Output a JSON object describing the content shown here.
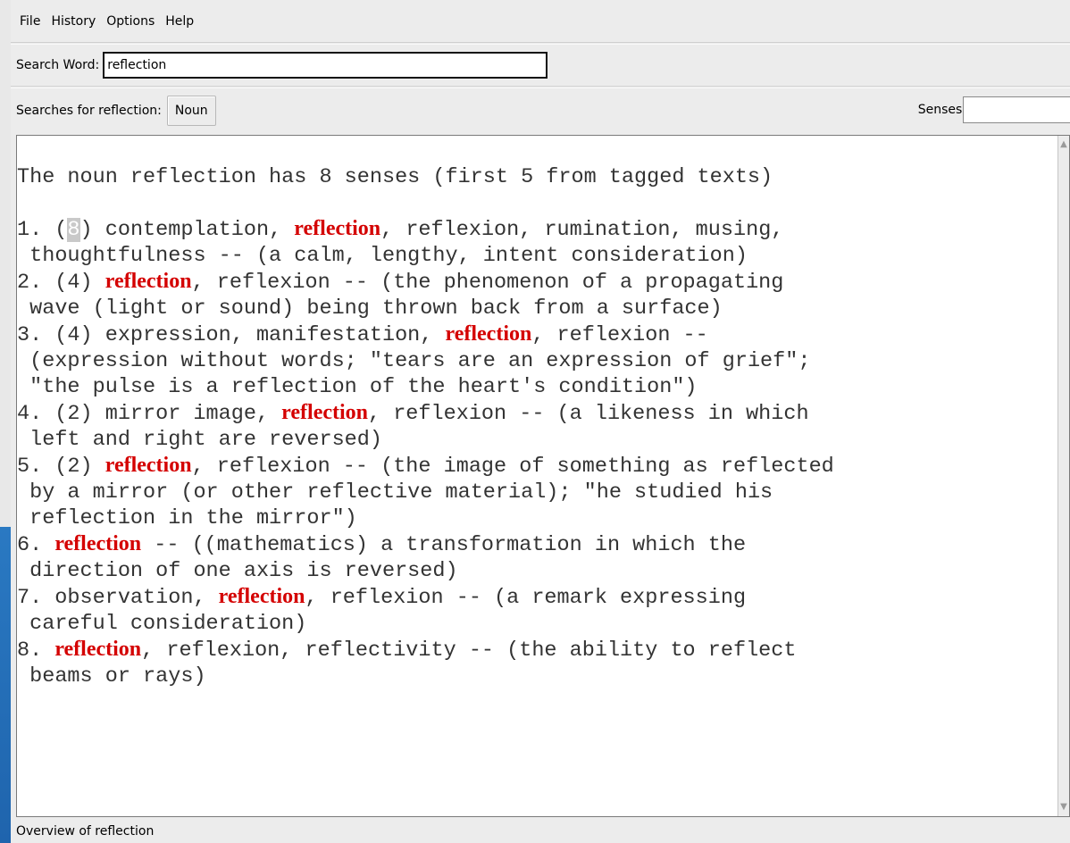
{
  "menu": [
    "File",
    "History",
    "Options",
    "Help"
  ],
  "search": {
    "label": "Search Word:",
    "value": "reflection"
  },
  "searches": {
    "label": "Searches for reflection:",
    "noun_button": "Noun",
    "senses_label": "Senses:",
    "senses_value": ""
  },
  "content": {
    "lines": [
      {
        "parts": [
          {
            "t": "The noun reflection has 8 senses (first 5 from tagged texts)"
          }
        ]
      },
      {
        "parts": [
          {
            "t": ""
          }
        ]
      },
      {
        "parts": [
          {
            "t": "1. ("
          },
          {
            "t": "8",
            "sel": true
          },
          {
            "t": ") contemplation, "
          },
          {
            "t": "reflection",
            "hl": true
          },
          {
            "t": ", reflexion, rumination, musing,"
          }
        ]
      },
      {
        "parts": [
          {
            "t": " thoughtfulness -- (a calm, lengthy, intent consideration)"
          }
        ]
      },
      {
        "parts": [
          {
            "t": "2. (4) "
          },
          {
            "t": "reflection",
            "hl": true
          },
          {
            "t": ", reflexion -- (the phenomenon of a propagating"
          }
        ]
      },
      {
        "parts": [
          {
            "t": " wave (light or sound) being thrown back from a surface)"
          }
        ]
      },
      {
        "parts": [
          {
            "t": "3. (4) expression, manifestation, "
          },
          {
            "t": "reflection",
            "hl": true
          },
          {
            "t": ", reflexion --"
          }
        ]
      },
      {
        "parts": [
          {
            "t": " (expression without words; \"tears are an expression of grief\";"
          }
        ]
      },
      {
        "parts": [
          {
            "t": " \"the pulse is a reflection of the heart's condition\")"
          }
        ]
      },
      {
        "parts": [
          {
            "t": "4. (2) mirror image, "
          },
          {
            "t": "reflection",
            "hl": true
          },
          {
            "t": ", reflexion -- (a likeness in which"
          }
        ]
      },
      {
        "parts": [
          {
            "t": " left and right are reversed)"
          }
        ]
      },
      {
        "parts": [
          {
            "t": "5. (2) "
          },
          {
            "t": "reflection",
            "hl": true
          },
          {
            "t": ", reflexion -- (the image of something as reflected"
          }
        ]
      },
      {
        "parts": [
          {
            "t": " by a mirror (or other reflective material); \"he studied his"
          }
        ]
      },
      {
        "parts": [
          {
            "t": " reflection in the mirror\")"
          }
        ]
      },
      {
        "parts": [
          {
            "t": "6. "
          },
          {
            "t": "reflection",
            "hl": true
          },
          {
            "t": " -- ((mathematics) a transformation in which the"
          }
        ]
      },
      {
        "parts": [
          {
            "t": " direction of one axis is reversed)"
          }
        ]
      },
      {
        "parts": [
          {
            "t": "7. observation, "
          },
          {
            "t": "reflection",
            "hl": true
          },
          {
            "t": ", reflexion -- (a remark expressing"
          }
        ]
      },
      {
        "parts": [
          {
            "t": " careful consideration)"
          }
        ]
      },
      {
        "parts": [
          {
            "t": "8. "
          },
          {
            "t": "reflection",
            "hl": true
          },
          {
            "t": ", reflexion, reflectivity -- (the ability to reflect"
          }
        ]
      },
      {
        "parts": [
          {
            "t": " beams or rays)"
          }
        ]
      }
    ]
  },
  "status": "Overview of reflection",
  "colors": {
    "highlight": "#d40000",
    "background": "#ececec",
    "desktop_edge": "#2a79c2"
  }
}
